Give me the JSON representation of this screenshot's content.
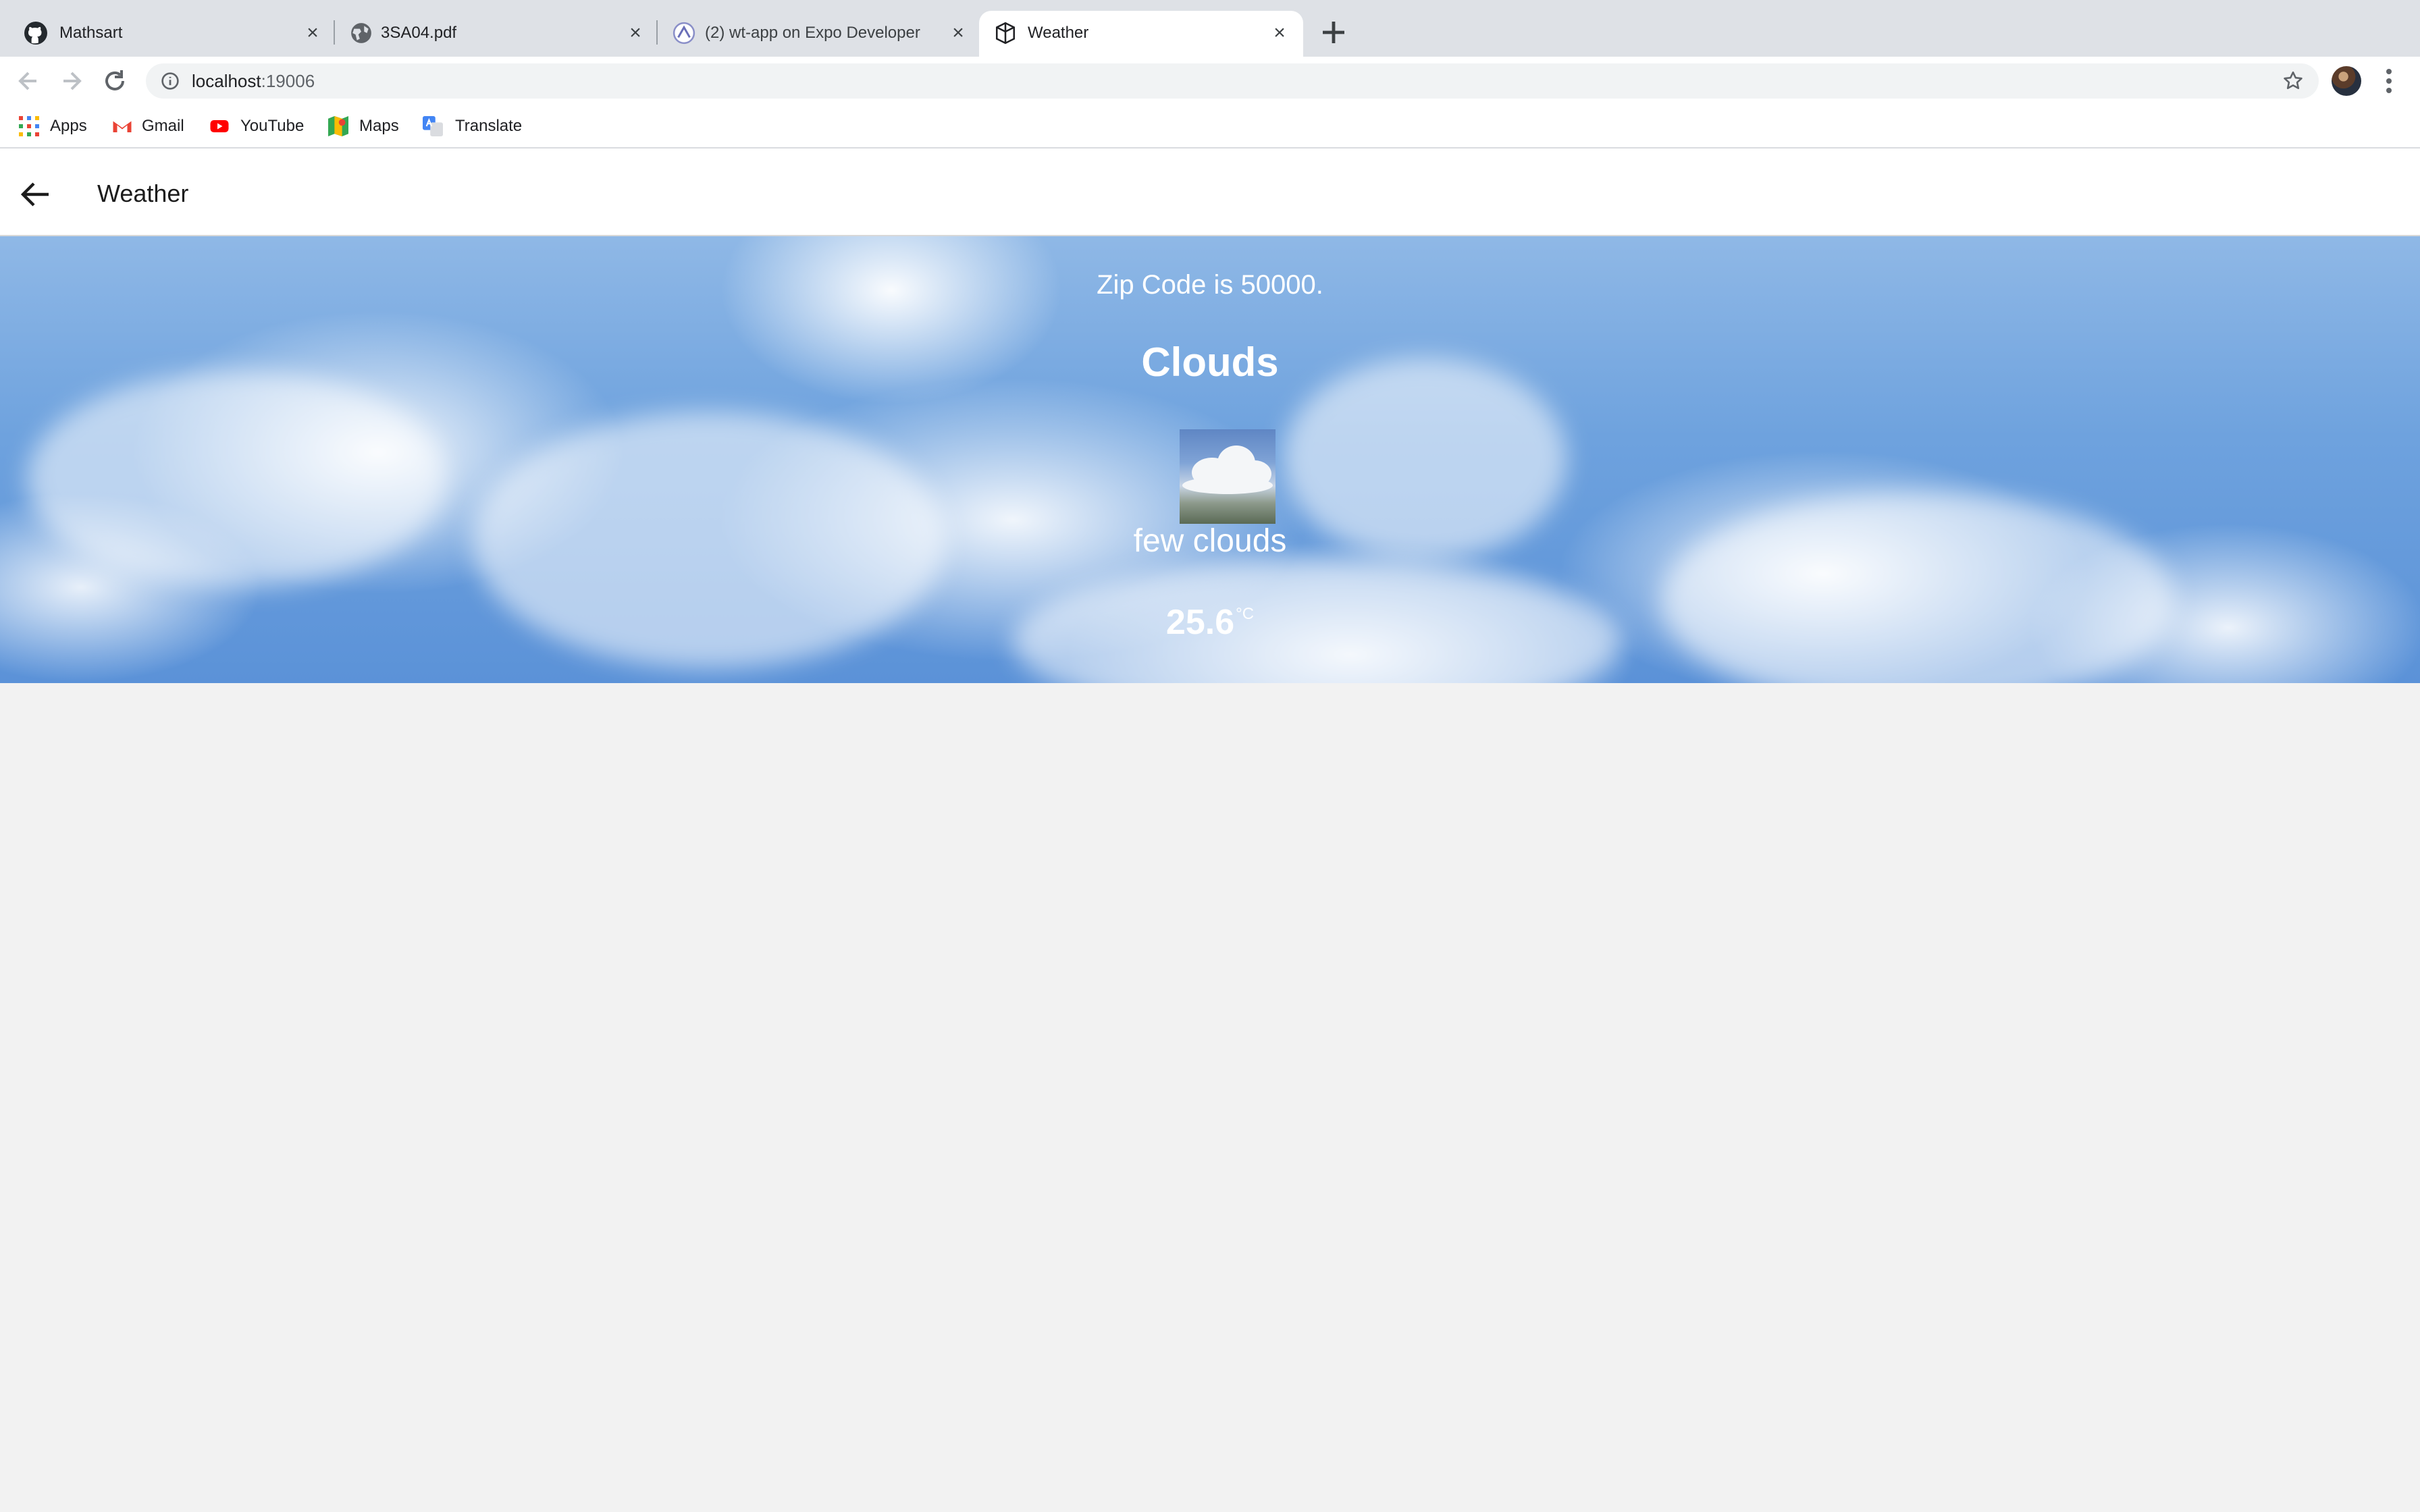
{
  "browser": {
    "tabs": [
      {
        "title": "Mathsart",
        "icon": "github-icon",
        "active": false
      },
      {
        "title": "3SA04.pdf",
        "icon": "globe-icon",
        "active": false
      },
      {
        "title": "(2) wt-app on Expo Developer",
        "icon": "expo-icon",
        "active": false
      },
      {
        "title": "Weather",
        "icon": "expo-app-icon",
        "active": true
      }
    ],
    "url": {
      "host": "localhost",
      "port": ":19006"
    },
    "bookmarks": [
      {
        "label": "Apps",
        "icon": "apps-grid-icon"
      },
      {
        "label": "Gmail",
        "icon": "gmail-icon"
      },
      {
        "label": "YouTube",
        "icon": "youtube-icon"
      },
      {
        "label": "Maps",
        "icon": "maps-icon"
      },
      {
        "label": "Translate",
        "icon": "translate-icon"
      }
    ]
  },
  "app": {
    "title": "Weather"
  },
  "weather": {
    "zip_text": "Zip Code is 50000.",
    "main": "Clouds",
    "description": "few clouds",
    "temperature": "25.6",
    "unit": "°C"
  },
  "colors": {
    "tabstrip_bg": "#dee1e6",
    "sky_blue": "#5b92d8",
    "page_bg": "#f2f2f2"
  }
}
